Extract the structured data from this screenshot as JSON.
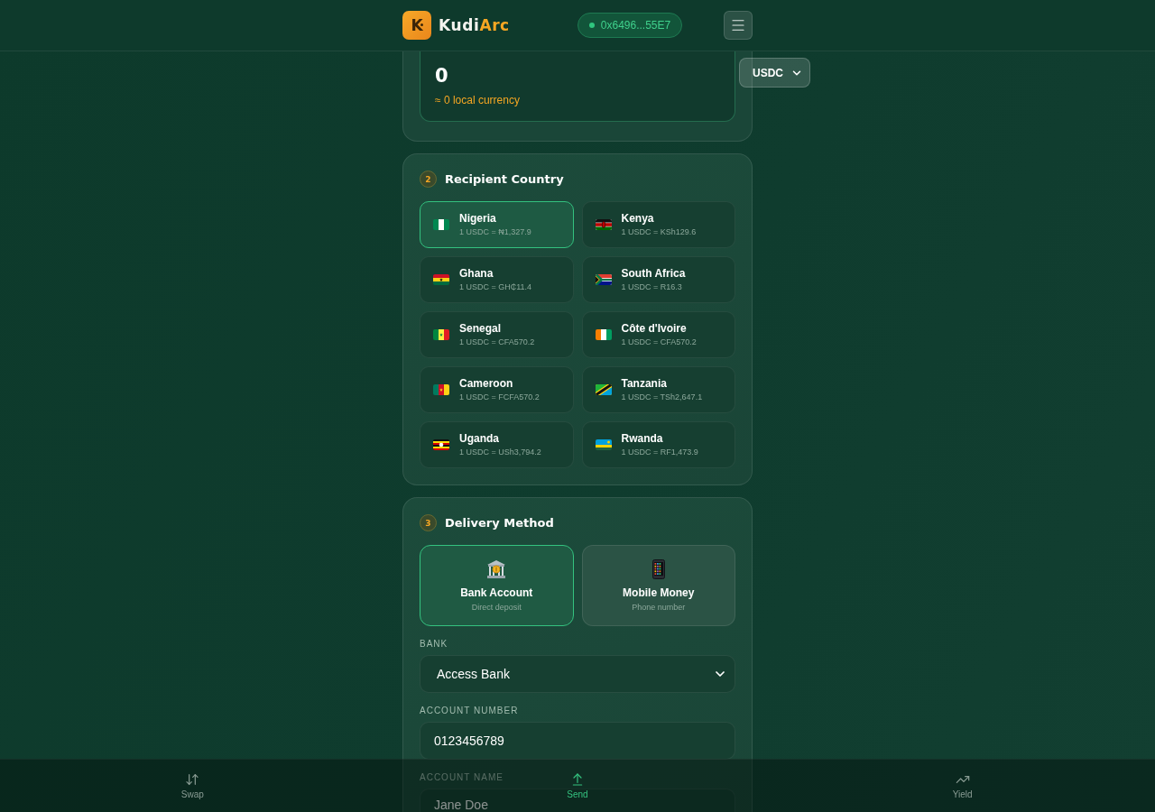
{
  "header": {
    "logo": {
      "mark": "K",
      "name": "Kudi",
      "name_accent": "Arc"
    },
    "wallet": {
      "address": "0x6496...55E7",
      "connected": true
    }
  },
  "amount": {
    "value": "0",
    "local_estimate": "≈ 0 local currency",
    "currency": "USDC"
  },
  "recipient_country": {
    "step": "2",
    "title": "Recipient Country",
    "countries": [
      {
        "name": "Nigeria",
        "rate": "1 USDC = ₦1,327.9",
        "selected": true
      },
      {
        "name": "Kenya",
        "rate": "1 USDC = KSh129.6",
        "selected": false
      },
      {
        "name": "Ghana",
        "rate": "1 USDC = GH₵11.4",
        "selected": false
      },
      {
        "name": "South Africa",
        "rate": "1 USDC = R16.3",
        "selected": false
      },
      {
        "name": "Senegal",
        "rate": "1 USDC = CFA570.2",
        "selected": false
      },
      {
        "name": "Côte d'Ivoire",
        "rate": "1 USDC = CFA570.2",
        "selected": false
      },
      {
        "name": "Cameroon",
        "rate": "1 USDC = FCFA570.2",
        "selected": false
      },
      {
        "name": "Tanzania",
        "rate": "1 USDC = TSh2,647.1",
        "selected": false
      },
      {
        "name": "Uganda",
        "rate": "1 USDC = USh3,794.2",
        "selected": false
      },
      {
        "name": "Rwanda",
        "rate": "1 USDC = RF1,473.9",
        "selected": false
      }
    ]
  },
  "delivery_method": {
    "step": "3",
    "title": "Delivery Method",
    "options": [
      {
        "kind": "bank",
        "title": "Bank Account",
        "subtitle": "Direct deposit",
        "selected": true
      },
      {
        "kind": "mobile",
        "title": "Mobile Money",
        "subtitle": "Phone number",
        "selected": false
      }
    ],
    "fields": [
      {
        "kind": "select",
        "label": "BANK",
        "value": "Access Bank"
      },
      {
        "kind": "input",
        "label": "ACCOUNT NUMBER",
        "value": "0123456789"
      },
      {
        "kind": "input",
        "label": "ACCOUNT NAME",
        "value": "Jane Doe"
      }
    ]
  },
  "bottom_nav": [
    {
      "kind": "swap",
      "label": "Swap",
      "selected": false
    },
    {
      "kind": "send",
      "label": "Send",
      "selected": true
    },
    {
      "kind": "yield",
      "label": "Yield",
      "selected": false
    }
  ]
}
